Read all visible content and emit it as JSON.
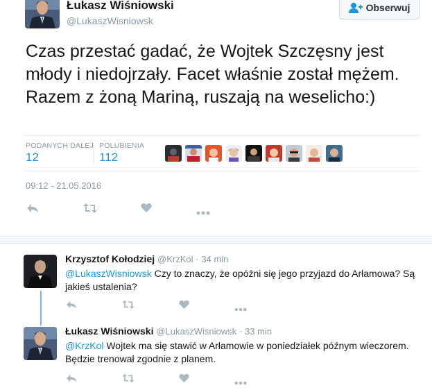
{
  "tweet": {
    "author_name": "Łukasz Wiśniowski",
    "author_handle": "@LukaszWisniowsk",
    "follow_label": "Obserwuj",
    "text": "Czas przestać gadać, że Wojtek Szczęsny jest młody i niedojrzały. Facet właśnie został mężem. Razem z żoną Mariną, ruszają na weselicho:)",
    "retweets_label": "PODANYCH DALEJ",
    "retweets_count": "12",
    "likes_label": "POLUBIENIA",
    "likes_count": "112",
    "timestamp": "09:12 - 21.05.2016"
  },
  "replies": [
    {
      "author_name": "Krzysztof Kołodziej",
      "author_handle": "@KrzKol",
      "time": "· 34 min",
      "mention": "@LukaszWisniowsk",
      "text": " Czy to znaczy, że opóźni się jego przyjazd do Arłamowa? Są jakieś ustalenia?"
    },
    {
      "author_name": "Łukasz Wiśniowski",
      "author_handle": "@LukaszWisniowsk",
      "time": "· 33 min",
      "mention": "@KrzKol",
      "text": " Wojtek ma się stawić w Arłamowie w poniedziałek późnym wieczorem. Będzie trenował zgodnie z planem."
    }
  ],
  "icons": {
    "reply": "reply-icon",
    "retweet": "retweet-icon",
    "like": "heart-icon",
    "more": "more-icon",
    "follow": "follow-user-icon"
  },
  "colors": {
    "link": "#1b95e0",
    "muted": "#8899a6",
    "action": "#aab8c2",
    "thread": "#75b7e8"
  }
}
